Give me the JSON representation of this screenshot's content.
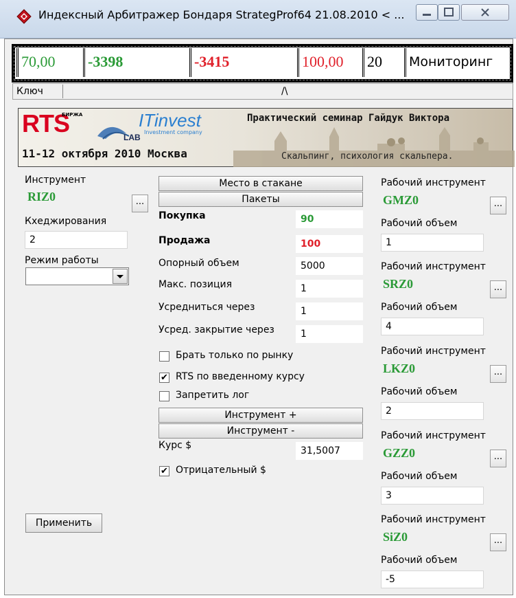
{
  "window": {
    "title": "Индексный Арбитражер Бондаря StrategProf64 21.08.2010  < ...",
    "minimize_glyph": "—",
    "maximize_glyph": "□",
    "close_glyph": "X"
  },
  "indicators": [
    "70,00",
    "-3398",
    "-3415",
    "100,00",
    "20",
    "Мониторинг"
  ],
  "header": {
    "key_label": "Ключ",
    "caret": "/\\"
  },
  "banner": {
    "brand": "RTS",
    "exchange_tag": "БИРЖА",
    "lab": "LAB",
    "partner": "ITinvest",
    "partner_sub": "Investment company",
    "title": "Практический семинар Гайдук Виктора",
    "date_place": "11-12 октября 2010 Москва",
    "subtitle": "Скальпинг, психология скальпера."
  },
  "left": {
    "instrument_label": "Инструмент",
    "instrument_value": "RIZ0",
    "browse": "...",
    "hedge_label": "Кхеджирования",
    "hedge_value": "2",
    "mode_label": "Режим работы",
    "mode_value": "",
    "apply_label": "Применить"
  },
  "center": {
    "place_button": "Место в стакане",
    "packets_button": "Пакеты",
    "buy_label": "Покупка",
    "buy_value": "90",
    "sell_label": "Продажа",
    "sell_value": "100",
    "base_volume_label": "Опорный объем",
    "base_volume_value": "5000",
    "max_position_label": "Макс. позиция",
    "max_position_value": "1",
    "average_label": "Усредниться через",
    "average_value": "1",
    "avg_close_label": "Усред. закрытие через",
    "avg_close_value": "1",
    "market_only_label": "Брать только по рынку",
    "market_only_checked": false,
    "rts_rate_label": "RTS по введенному курсу",
    "rts_rate_checked": true,
    "no_log_label": "Запретить лог",
    "no_log_checked": false,
    "instrument_plus": "Инструмент +",
    "instrument_minus": "Инструмент -",
    "rate_label": "Курс $",
    "rate_value": "31,5007",
    "negative_label": "Отрицательный $",
    "negative_checked": true
  },
  "right": {
    "items": [
      {
        "label": "Рабочий инструмент",
        "instrument": "GMZ0",
        "volume_label": "Рабочий объем",
        "volume": "1"
      },
      {
        "label": "Рабочий инструмент",
        "instrument": "SRZ0",
        "volume_label": "Рабочий объем",
        "volume": "4"
      },
      {
        "label": "Рабочий инструмент",
        "instrument": "LKZ0",
        "volume_label": "Рабочий объем",
        "volume": "2"
      },
      {
        "label": "Рабочий инструмент",
        "instrument": "GZZ0",
        "volume_label": "Рабочий объем",
        "volume": "3"
      },
      {
        "label": "Рабочий инструмент",
        "instrument": "SiZ0",
        "volume_label": "Рабочий объем",
        "volume": "-5"
      }
    ]
  },
  "check_glyph": "✔",
  "colors": {
    "green": "#2a9a36",
    "red": "#e0202a",
    "accent": "#2a7fd0"
  }
}
